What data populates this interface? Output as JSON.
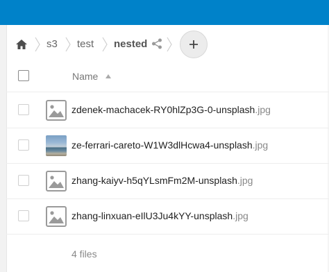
{
  "colors": {
    "header_bar": "#0082c9",
    "add_button_bg": "#ececec"
  },
  "breadcrumb": {
    "home_icon": "home-icon",
    "items": [
      "s3",
      "test",
      "nested"
    ],
    "share_icon": "share-icon",
    "add_icon": "plus-icon"
  },
  "table": {
    "name_header": "Name",
    "sort_icon": "sort-ascending-icon",
    "files": [
      {
        "name": "zdenek-machacek-RY0hlZp3G-0-unsplash",
        "ext": ".jpg",
        "thumb": "image-placeholder-icon"
      },
      {
        "name": "ze-ferrari-careto-W1W3dlHcwa4-unsplash",
        "ext": ".jpg",
        "thumb": "photo-thumbnail"
      },
      {
        "name": "zhang-kaiyv-h5qYLsmFm2M-unsplash",
        "ext": ".jpg",
        "thumb": "image-placeholder-icon"
      },
      {
        "name": "zhang-linxuan-eIlU3Ju4kYY-unsplash",
        "ext": ".jpg",
        "thumb": "image-placeholder-icon"
      }
    ]
  },
  "footer": {
    "summary": "4 files"
  }
}
